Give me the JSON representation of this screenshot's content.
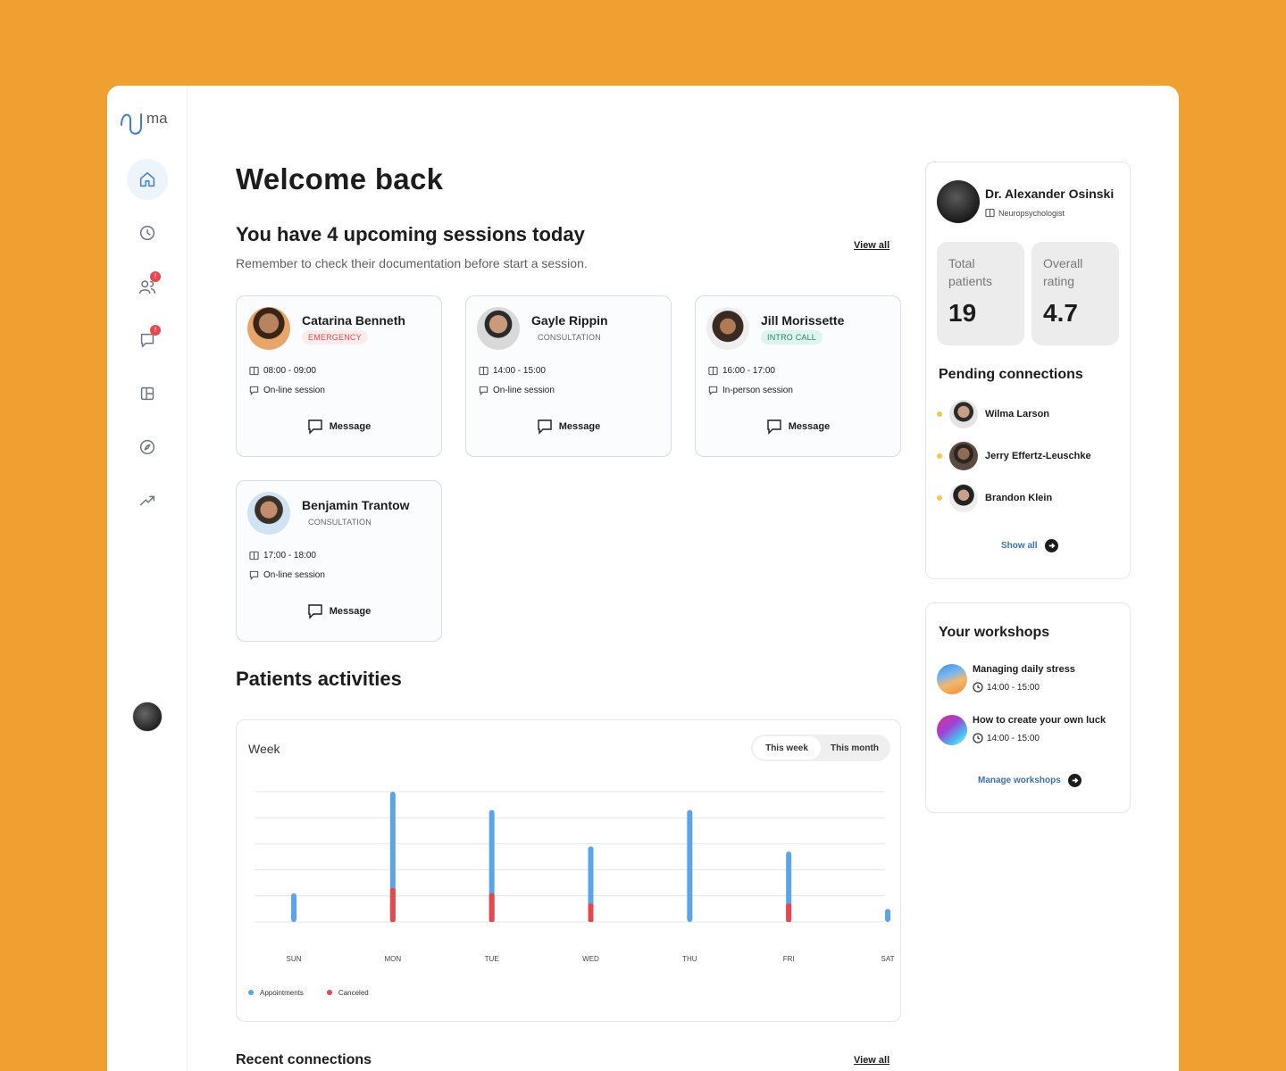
{
  "app": {
    "logo_text": "uma"
  },
  "colors": {
    "background": "#F0A030",
    "accent": "#3B7FD1",
    "appointments": "#5AA5E8",
    "canceled": "#E5484D",
    "pending": "#F4C94A"
  },
  "sidebar": {
    "items": [
      {
        "name": "home-icon",
        "active": true
      },
      {
        "name": "clock-icon"
      },
      {
        "name": "users-icon",
        "badge": "!"
      },
      {
        "name": "chat-icon",
        "badge": "!"
      },
      {
        "name": "layout-icon"
      },
      {
        "name": "compass-icon"
      },
      {
        "name": "trend-icon"
      }
    ]
  },
  "main": {
    "welcome": "Welcome back",
    "sessions_title": "You have 4 upcoming sessions today",
    "sessions_sub": "Remember to check their documentation before start a session.",
    "view_all": "View all",
    "message_label": "Message",
    "cards": [
      {
        "name": "Catarina Benneth",
        "tag": "EMERGENCY",
        "time": "08:00 - 09:00",
        "mode": "On-line session"
      },
      {
        "name": "Gayle Rippin",
        "tag": "CONSULTATION",
        "time": "14:00 - 15:00",
        "mode": "On-line session"
      },
      {
        "name": "Jill Morissette",
        "tag": "INTRO CALL",
        "time": "16:00 - 17:00",
        "mode": "In-person session"
      },
      {
        "name": "Benjamin Trantow",
        "tag": "CONSULTATION",
        "time": "17:00 - 18:00",
        "mode": "On-line session"
      }
    ],
    "activities_title": "Patients activities",
    "chart_label": "Week",
    "toggle": [
      "This week",
      "This month"
    ],
    "recent_title": "Recent connections"
  },
  "chart_data": {
    "type": "bar",
    "categories": [
      "SUN",
      "MON",
      "TUE",
      "WED",
      "THU",
      "FRI",
      "SAT"
    ],
    "series": [
      {
        "name": "Appointments",
        "values": [
          11,
          50,
          43,
          29,
          43,
          27,
          5
        ]
      },
      {
        "name": "Canceled",
        "values": [
          0,
          13,
          11,
          7,
          0,
          7,
          0
        ]
      }
    ],
    "stacked": true,
    "ylim": [
      0,
      50
    ],
    "grid": true,
    "legend": "bottom-left"
  },
  "profile": {
    "name": "Dr. Alexander Osinski",
    "role": "Neuropsychologist",
    "stats": [
      {
        "label": "Total patients",
        "value": "19"
      },
      {
        "label": "Overall rating",
        "value": "4.7"
      }
    ],
    "pending_title": "Pending connections",
    "pending": [
      "Wilma Larson",
      "Jerry Effertz-Leuschke",
      "Brandon Klein"
    ],
    "show_all": "Show all"
  },
  "workshops": {
    "title": "Your workshops",
    "items": [
      {
        "name": "Managing daily stress",
        "time": "14:00 - 15:00"
      },
      {
        "name": "How to create your own luck",
        "time": "14:00 - 15:00"
      }
    ],
    "manage": "Manage workshops"
  }
}
